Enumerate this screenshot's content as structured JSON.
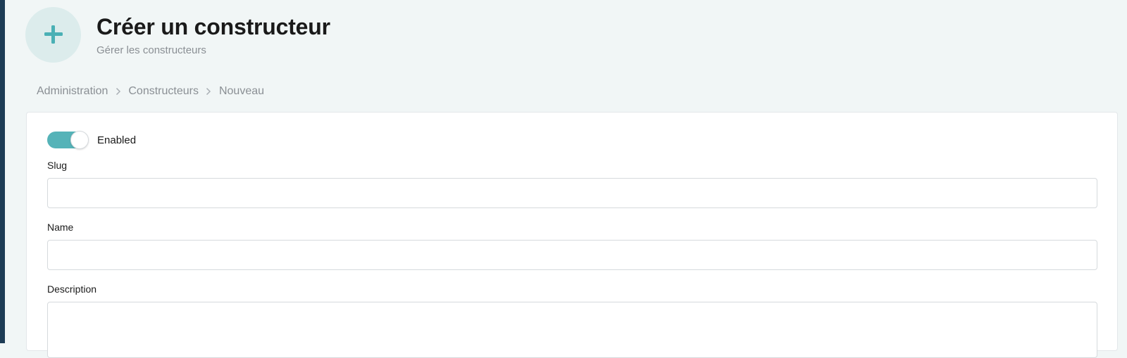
{
  "header": {
    "title": "Créer un constructeur",
    "subtitle": "Gérer les constructeurs",
    "icon": "plus-icon"
  },
  "breadcrumb": {
    "items": [
      "Administration",
      "Constructeurs",
      "Nouveau"
    ]
  },
  "form": {
    "enabled": {
      "label": "Enabled",
      "checked": true
    },
    "slug": {
      "label": "Slug",
      "value": ""
    },
    "name": {
      "label": "Name",
      "value": ""
    },
    "description": {
      "label": "Description",
      "value": ""
    }
  },
  "colors": {
    "accent": "#55b3b8",
    "sidebar_edge": "#1d3c55",
    "background": "#f1f6f6",
    "icon_circle": "#dcecec"
  }
}
